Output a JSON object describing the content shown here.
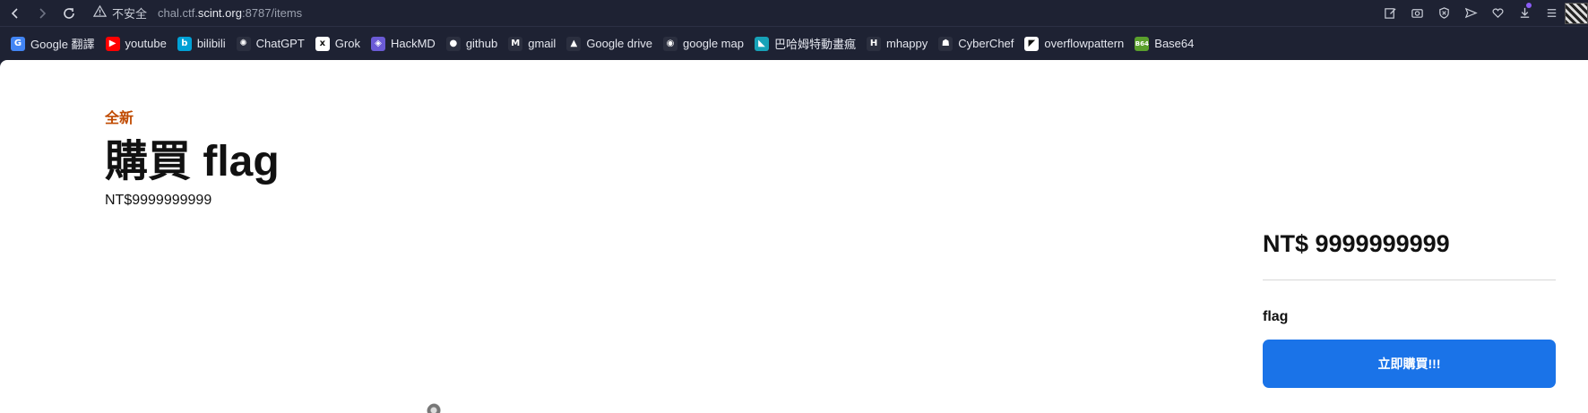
{
  "browser": {
    "insecure_label": "不安全",
    "url_prefix": "chal.ctf.",
    "url_domain": "scint.org",
    "url_suffix": ":8787/items",
    "icons": [
      "back-icon",
      "forward-icon",
      "reload-icon",
      "warning-icon",
      "edit-icon",
      "camera-icon",
      "shield-icon",
      "send-icon",
      "heart-icon",
      "download-icon",
      "menu-icon"
    ]
  },
  "bookmarks": [
    {
      "label": "Google 翻譯",
      "icon": "google-translate-icon",
      "color": "#4285f4",
      "glyph": "G"
    },
    {
      "label": "youtube",
      "icon": "youtube-icon",
      "color": "#ff0000",
      "glyph": "▶"
    },
    {
      "label": "bilibili",
      "icon": "bilibili-icon",
      "color": "#00a1d6",
      "glyph": "b"
    },
    {
      "label": "ChatGPT",
      "icon": "chatgpt-icon",
      "color": "#2b2f3f",
      "glyph": "✺"
    },
    {
      "label": "Grok",
      "icon": "grok-icon",
      "color": "#ffffff",
      "glyph": "x"
    },
    {
      "label": "HackMD",
      "icon": "hackmd-icon",
      "color": "#6b5bd6",
      "glyph": "◈"
    },
    {
      "label": "github",
      "icon": "github-icon",
      "color": "#2b2f3f",
      "glyph": "●"
    },
    {
      "label": "gmail",
      "icon": "gmail-icon",
      "color": "#2b2f3f",
      "glyph": "M"
    },
    {
      "label": "Google drive",
      "icon": "google-drive-icon",
      "color": "#2b2f3f",
      "glyph": "▲"
    },
    {
      "label": "google map",
      "icon": "google-map-icon",
      "color": "#2b2f3f",
      "glyph": "◉"
    },
    {
      "label": "巴哈姆特動畫瘋",
      "icon": "bahamut-anime-icon",
      "color": "#17a2b8",
      "glyph": "◣"
    },
    {
      "label": "mhappy",
      "icon": "mhappy-icon",
      "color": "#2b2f3f",
      "glyph": "H"
    },
    {
      "label": "CyberChef",
      "icon": "cyberchef-icon",
      "color": "#2b2f3f",
      "glyph": "☗"
    },
    {
      "label": "overflowpattern",
      "icon": "overflowpattern-icon",
      "color": "#ffffff",
      "glyph": "◤"
    },
    {
      "label": "Base64",
      "icon": "base64-icon",
      "color": "#5aa02c",
      "glyph": "B64"
    }
  ],
  "item": {
    "condition": "全新",
    "title": "購買 flag",
    "price_text": "NT$9999999999"
  },
  "panel": {
    "price": "NT$ 9999999999",
    "name": "flag",
    "buy_label": "立即購買!!!"
  },
  "colors": {
    "condition": "#c04a00",
    "buy_button": "#1a73e8",
    "chrome_bg": "#1e2233"
  }
}
